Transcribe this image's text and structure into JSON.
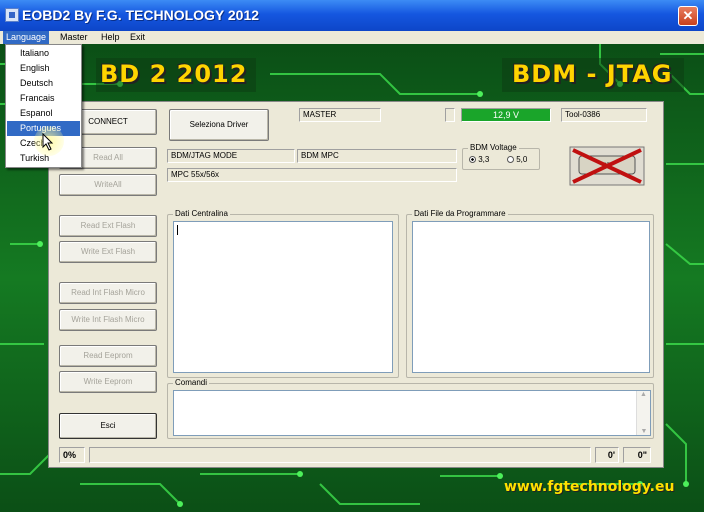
{
  "window": {
    "title": "EOBD2 By F.G. TECHNOLOGY 2012",
    "close_glyph": "✕"
  },
  "menu": [
    {
      "label": "Language",
      "active": true
    },
    {
      "label": "Master"
    },
    {
      "label": "Help"
    },
    {
      "label": "Exit"
    }
  ],
  "language_menu": {
    "items": [
      "Italiano",
      "English",
      "Deutsch",
      "Francais",
      "Espanol",
      "Portugues",
      "Czech",
      "Turkish"
    ],
    "highlighted": "Portugues"
  },
  "banner": {
    "left_text": "BD 2 2012",
    "right_text": "BDM - JTAG",
    "url": "www.fgtechnology.eu"
  },
  "buttons": {
    "connect": "CONNECT",
    "select_driver": "Seleziona Driver",
    "read_all": "Read All",
    "write_all": "WriteAll",
    "read_ext_flash": "Read Ext Flash",
    "write_ext_flash": "Write Ext Flash",
    "read_int_flash": "Read Int Flash Micro",
    "write_int_flash": "Write Int Flash Micro",
    "read_eeprom": "Read Eeprom",
    "write_eeprom": "Write Eeprom",
    "exit": "Esci"
  },
  "status": {
    "master": "MASTER",
    "voltage": "12,9 V",
    "tool": "Tool-0386",
    "mode": "BDM/JTAG  MODE",
    "bdm_type": "BDM MPC",
    "micro": "MPC 55x/56x"
  },
  "bdm_voltage": {
    "label": "BDM Voltage",
    "options": [
      "3,3",
      "5,0"
    ],
    "selected": "3,3"
  },
  "sections": {
    "ecu_data": "Dati Centralina",
    "file_data": "Dati File da Programmare",
    "commands": "Comandi"
  },
  "progress": {
    "percent_label": "0%",
    "time_min": "0'",
    "time_sec": "0\""
  },
  "colors": {
    "voltage_bar": "#1aa52a",
    "accent": "#316ac5",
    "banner_yellow": "#ffd400"
  },
  "icons": {
    "start_stop": "start-crossed-icon"
  }
}
